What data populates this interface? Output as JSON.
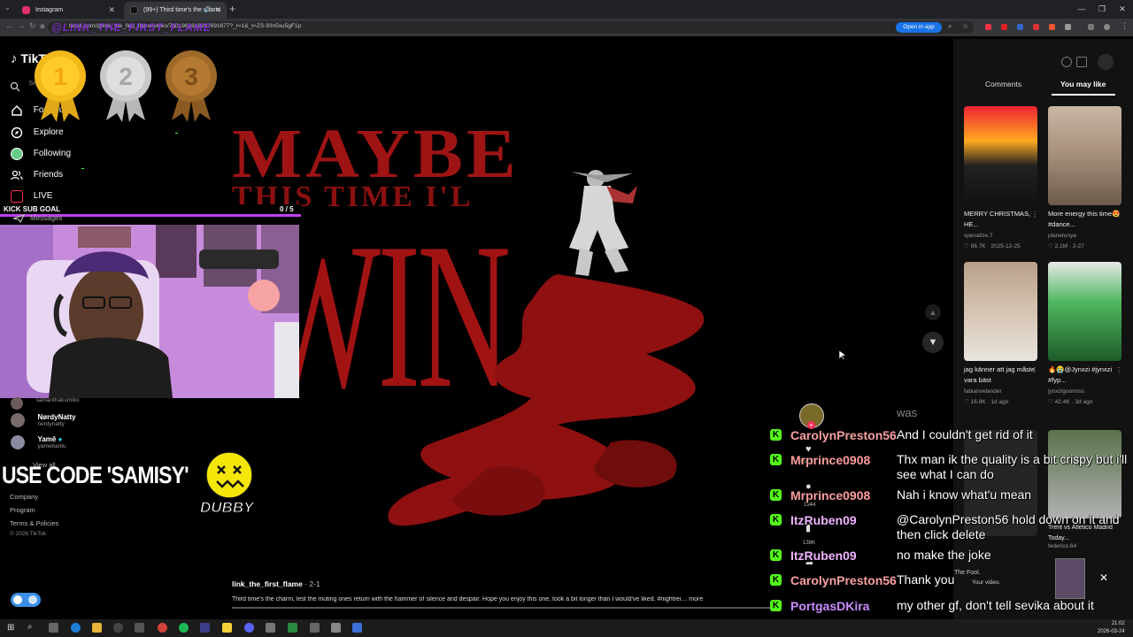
{
  "browser": {
    "tabs": [
      {
        "title": "Instagram",
        "active": false
      },
      {
        "title": "(99+) Third time's the charm",
        "active": true
      }
    ],
    "url": "tiktok.com/@link_the_first_flame/video/7601965628957691677?_r=1&_t=ZS-93n5su5gF1p",
    "open_in_app": "Open in app",
    "overlay_url_text": "@LINK_THE_FIRST_FLAME"
  },
  "tiktok": {
    "logo": "TikTok",
    "search_placeholder": "Search",
    "nav": [
      "For You",
      "Explore",
      "Following",
      "Friends",
      "LIVE",
      "Messages"
    ],
    "friends": [
      {
        "name": "",
        "handle": "samanthakumiko"
      },
      {
        "name": "NørdyNatty",
        "handle": "nerdynatty"
      },
      {
        "name": "Yamê",
        "handle": "yamebantu"
      }
    ],
    "view_all": "View all",
    "footer": [
      "Company",
      "Program",
      "Terms & Policies",
      "© 2026 TikTok"
    ]
  },
  "video": {
    "title_line1": "MAYBE",
    "title_line2": "THIS TIME I'L",
    "title_line3": "WIN",
    "author": "link_the_first_flame",
    "author_age": "· 2-1",
    "caption": "Third time's the charm, lest the muting ones return with the hammer of silence and despair. Hope you enjoy this one, took a bit longer than I would've liked. #nightrei…  more"
  },
  "panel": {
    "tabs": {
      "comments": "Comments",
      "you_may_like": "You may like"
    },
    "recommendations": [
      {
        "title": "MERRY CHRISTMAS, HE...",
        "user": "spexalize.7",
        "views": "86.7K",
        "date": "2025-12-25"
      },
      {
        "title": "More energy this time😍 #dance...",
        "user": "planetunya",
        "views": "2.1M",
        "date": "2-27"
      },
      {
        "title": "jag känner att jag måste vara bäst",
        "user": "fabianvelander",
        "views": "16.8K",
        "date": "1d ago"
      },
      {
        "title": "🔥😭@Jynxzi #jynxzi #fyp...",
        "user": "jynxzigoonnss",
        "views": "42.4K",
        "date": "3d ago"
      }
    ],
    "partial": {
      "title": "Trent vs Atletico Madrid Today...",
      "user": "federico.64",
      "extra": "The Fool.",
      "extra2": "Your video."
    }
  },
  "stream": {
    "kick_sub_goal": "KICK SUB GOAL",
    "kick_count": "0 / 5",
    "kick_progress": 0,
    "use_code": "USE CODE 'SAMISY'",
    "dubby": "DUBBY",
    "medals": [
      "1",
      "2",
      "3"
    ]
  },
  "chat": [
    {
      "user": "CarolynPreston56",
      "color": "#f9a0a0",
      "msg": "And I couldn't get rid of it"
    },
    {
      "user": "Mrprince0908",
      "color": "#ff9d9d",
      "msg": "Thx man ik the quality is a bit crispy but i'll see what I can do"
    },
    {
      "user": "Mrprince0908",
      "color": "#ff9d9d",
      "msg": "Nah i know what'u mean"
    },
    {
      "user": "ItzRuben09",
      "color": "#f0b2ff",
      "msg": "@CarolynPreston56 hold down on it and then click delete"
    },
    {
      "user": "ItzRuben09",
      "color": "#f0b2ff",
      "msg": "no make the joke"
    },
    {
      "user": "CarolynPreston56",
      "color": "#f9a0a0",
      "msg": "Thank you"
    },
    {
      "user": "PortgasDKira",
      "color": "#c98cff",
      "msg": "my other gf, don't tell sevika about it"
    }
  ],
  "chat_was": "was",
  "side_counts": [
    "652.7K",
    "1944",
    "138K"
  ],
  "clock": {
    "time": "21:02",
    "date": "2026-03-24"
  },
  "colors": {
    "accent_tiktok": "#fe2c55",
    "kick_green": "#53fc18",
    "blood_red": "#9e1414",
    "goal_purple": "#c03ff3"
  }
}
